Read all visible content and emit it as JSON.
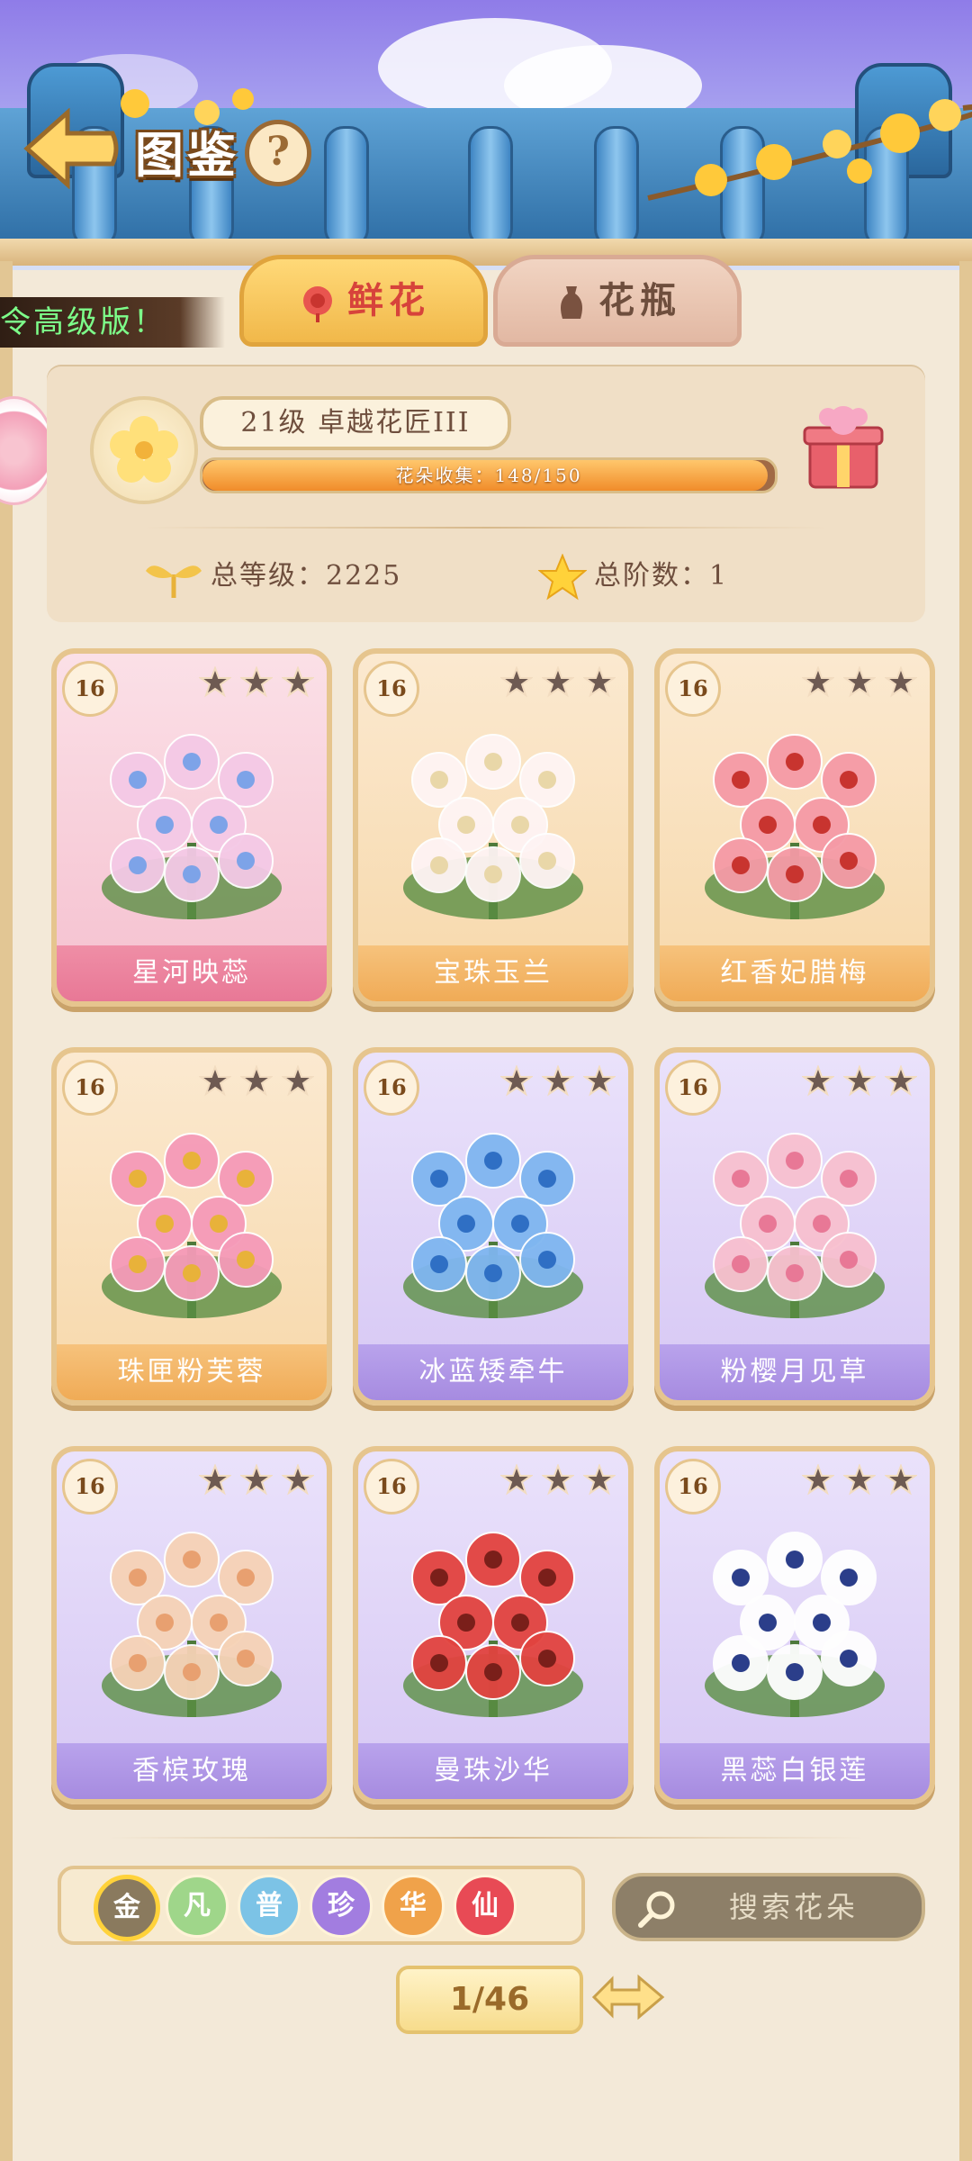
{
  "header": {
    "title": "图鉴",
    "help": "?"
  },
  "tabs": [
    {
      "label": "鲜花",
      "active": true
    },
    {
      "label": "花瓶",
      "active": false
    }
  ],
  "banner": {
    "text": "令高级版！"
  },
  "profile": {
    "level_title": "21级  卓越花匠III",
    "progress_text": "花朵收集：148/150",
    "collected": 148,
    "total": 150,
    "total_level": "总等级：2225",
    "total_stage": "总阶数：1"
  },
  "cards": [
    {
      "num": "16",
      "name": "星河映蕊",
      "theme": "pink"
    },
    {
      "num": "16",
      "name": "宝珠玉兰",
      "theme": "peach"
    },
    {
      "num": "16",
      "name": "红香妃腊梅",
      "theme": "peach"
    },
    {
      "num": "16",
      "name": "珠匣粉芙蓉",
      "theme": "peach"
    },
    {
      "num": "16",
      "name": "冰蓝矮牵牛",
      "theme": "lav"
    },
    {
      "num": "16",
      "name": "粉樱月见草",
      "theme": "lav"
    },
    {
      "num": "16",
      "name": "香槟玫瑰",
      "theme": "lav"
    },
    {
      "num": "16",
      "name": "曼珠沙华",
      "theme": "lav"
    },
    {
      "num": "16",
      "name": "黑蕊白银莲",
      "theme": "lav"
    }
  ],
  "filters": [
    {
      "label": "金",
      "color": "#8a7a5e",
      "selected": true
    },
    {
      "label": "凡",
      "color": "#9fd68a"
    },
    {
      "label": "普",
      "color": "#7cc3e6"
    },
    {
      "label": "珍",
      "color": "#a27de0"
    },
    {
      "label": "华",
      "color": "#f0a24a"
    },
    {
      "label": "仙",
      "color": "#e84a55"
    }
  ],
  "search": {
    "placeholder": "搜索花朵"
  },
  "pager": {
    "text": "1/46"
  }
}
